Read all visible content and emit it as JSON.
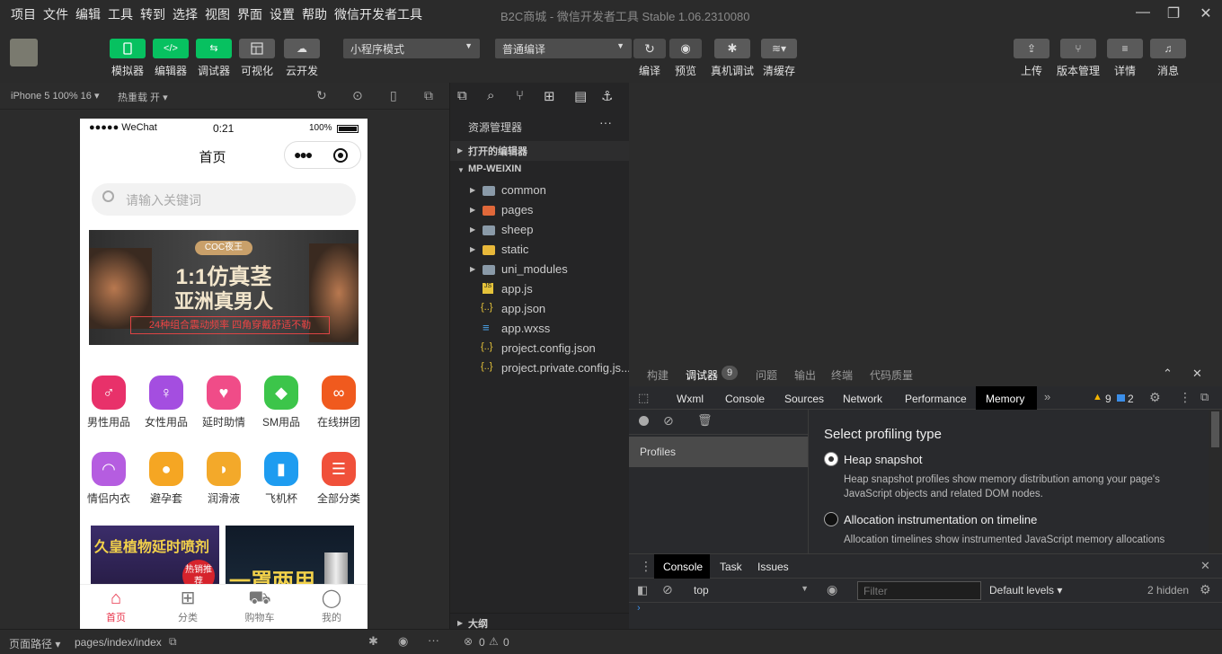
{
  "menu": [
    "项目",
    "文件",
    "编辑",
    "工具",
    "转到",
    "选择",
    "视图",
    "界面",
    "设置",
    "帮助",
    "微信开发者工具"
  ],
  "window_title": "B2C商城 - 微信开发者工具 Stable 1.06.2310080",
  "toolbar": {
    "left_labels": [
      "模拟器",
      "编辑器",
      "调试器",
      "可视化",
      "云开发"
    ],
    "mode_select": "小程序模式",
    "compile_select": "普通编译",
    "mid_labels": [
      "编译",
      "预览",
      "真机调试",
      "清缓存"
    ],
    "right_labels": [
      "上传",
      "版本管理",
      "详情",
      "消息"
    ]
  },
  "simulator_bar": {
    "device": "iPhone 5 100% 16",
    "hot_reload": "热重载 开"
  },
  "phone": {
    "carrier": "●●●●● WeChat",
    "time": "0:21",
    "battery": "100%",
    "nav_title": "首页",
    "search_placeholder": "请输入关键词",
    "banner": {
      "tag": "COC夜王",
      "headline1": "1:1仿真茎",
      "headline2": "亚洲真男人",
      "sub": "24种组合震动频率  四角穿戴舒适不勒"
    },
    "categories": [
      "男性用品",
      "女性用品",
      "延时助情",
      "SM用品",
      "在线拼团",
      "情侣内衣",
      "避孕套",
      "润滑液",
      "飞机杯",
      "全部分类"
    ],
    "products": [
      {
        "title": "久皇植物延时喷剂",
        "badge": "热销推荐"
      },
      {
        "title": "一罩两用"
      }
    ],
    "tabs": [
      "首页",
      "分类",
      "购物车",
      "我的"
    ]
  },
  "explorer": {
    "title": "资源管理器",
    "open_editors": "打开的编辑器",
    "project": "MP-WEIXIN",
    "folders": [
      "common",
      "pages",
      "sheep",
      "static",
      "uni_modules"
    ],
    "files": [
      "app.js",
      "app.json",
      "app.wxss",
      "project.config.json",
      "project.private.config.js..."
    ],
    "outline": "大纲"
  },
  "devtools": {
    "top_tabs": [
      "构建",
      "调试器",
      "问题",
      "输出",
      "终端",
      "代码质量"
    ],
    "debugger_count": "9",
    "panel_tabs": [
      "Wxml",
      "Console",
      "Sources",
      "Network",
      "Performance",
      "Memory"
    ],
    "warn_count": "9",
    "info_count": "2",
    "profiles_label": "Profiles",
    "heading": "Select profiling type",
    "options": [
      {
        "title": "Heap snapshot",
        "desc1": "Heap snapshot profiles show memory distribution among your page's",
        "desc2": "JavaScript objects and related DOM nodes."
      },
      {
        "title": "Allocation instrumentation on timeline",
        "desc1": "Allocation timelines show instrumented JavaScript memory allocations",
        "desc2": ""
      }
    ],
    "drawer_tabs": [
      "Console",
      "Task",
      "Issues"
    ],
    "context": "top",
    "filter_placeholder": "Filter",
    "levels": "Default levels",
    "hidden": "2 hidden"
  },
  "statusbar": {
    "path_label": "页面路径",
    "path": "pages/index/index",
    "errors": "0",
    "warnings": "0"
  }
}
